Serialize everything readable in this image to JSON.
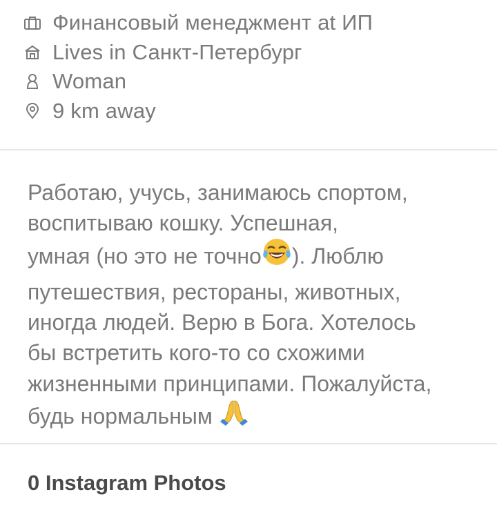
{
  "info": {
    "job": {
      "icon": "briefcase-icon",
      "text": "Финансовый менеджмент at ИП"
    },
    "city": {
      "icon": "home-icon",
      "text": "Lives in Санкт-Петербург"
    },
    "gender": {
      "icon": "person-icon",
      "text": "Woman"
    },
    "distance": {
      "icon": "location-pin-icon",
      "text": "9 km away"
    }
  },
  "bio": {
    "lines": [
      "Работаю, учусь, занимаюсь спортом,",
      "воспитываю кошку. Успешная,",
      "умная (но это не точно",
      "). Люблю",
      "путешествия, рестораны, животных,",
      "иногда людей. Верю в Бога. Хотелось",
      "бы встретить кого-то со схожими",
      "жизненными принципами. Пожалуйста,",
      "будь нормальным "
    ],
    "emojis": [
      "joy-emoji",
      "folded-hands-emoji"
    ]
  },
  "instagram": {
    "title": "0 Instagram Photos"
  },
  "colors": {
    "text": "#7a7a7a",
    "heading": "#4a4a4a",
    "divider": "#e6e6e6",
    "icon": "#7a7a7a"
  }
}
